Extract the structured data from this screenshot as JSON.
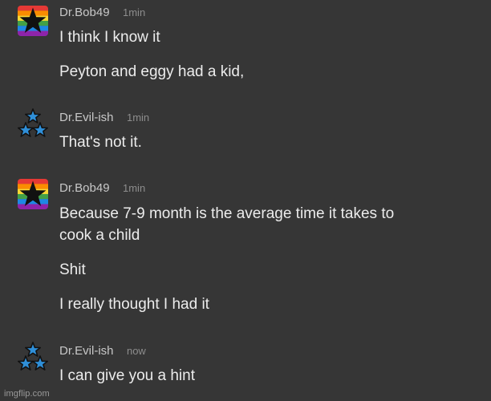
{
  "messages": [
    {
      "username": "Dr.Bob49",
      "timestamp": "1min",
      "avatar_icon": "rainbow-star-icon",
      "lines": [
        "I think I know it",
        "Peyton and eggy had a kid,"
      ]
    },
    {
      "username": "Dr.Evil-ish",
      "timestamp": "1min",
      "avatar_icon": "three-stars-icon",
      "lines": [
        "That's not it."
      ]
    },
    {
      "username": "Dr.Bob49",
      "timestamp": "1min",
      "avatar_icon": "rainbow-star-icon",
      "lines": [
        "Because 7-9 month is the average time it takes to",
        "cook a child",
        "Shit",
        "I really thought I had it"
      ]
    },
    {
      "username": "Dr.Evil-ish",
      "timestamp": "now",
      "avatar_icon": "three-stars-icon",
      "lines": [
        "I can give you a hint"
      ]
    }
  ],
  "watermark": "imgflip.com",
  "colors": {
    "background": "#363636",
    "text": "#ececec",
    "username": "#c8c8c8",
    "timestamp": "#8d8d8d",
    "star_blue": "#2f8fd8"
  }
}
